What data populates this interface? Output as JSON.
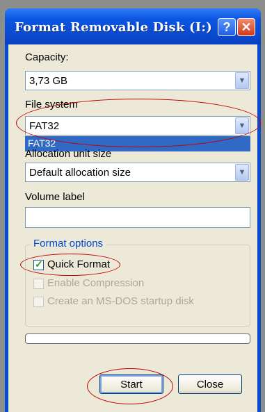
{
  "window": {
    "title": "Format Removable Disk (I:)"
  },
  "titlebar_buttons": {
    "help": "?",
    "close": "✕"
  },
  "capacity": {
    "label": "Capacity:",
    "value": "3,73 GB"
  },
  "file_system": {
    "label": "File system",
    "value": "FAT32",
    "dropdown_highlighted": "FAT32"
  },
  "allocation": {
    "label": "Allocation unit size",
    "value": "Default allocation size"
  },
  "volume_label": {
    "label": "Volume label",
    "value": ""
  },
  "format_options": {
    "legend": "Format options",
    "quick_format": {
      "label": "Quick Format",
      "checked": true,
      "enabled": true
    },
    "enable_compression": {
      "label": "Enable Compression",
      "checked": false,
      "enabled": false
    },
    "ms_dos_startup": {
      "label": "Create an MS-DOS startup disk",
      "checked": false,
      "enabled": false
    }
  },
  "progress": {
    "value": 0
  },
  "buttons": {
    "start": "Start",
    "close": "Close"
  },
  "colors": {
    "title_bar": "#0a4bd2",
    "dialog_bg": "#ece9d8",
    "annotation": "#c00000",
    "selection": "#316ac5"
  }
}
